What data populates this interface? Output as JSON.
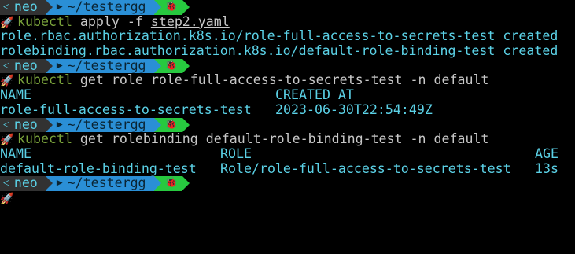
{
  "prompt": {
    "user": "neo",
    "dir": "~/testergg",
    "user_icon": "triangle-left-icon",
    "dir_icon": "folder-icon",
    "status_icon": "bug-icon",
    "colors": {
      "user_bg": "#323232",
      "dir_bg": "#2a8fd6",
      "status_bg": "#27c93f",
      "text": "#5bd1e6",
      "keyword": "#7aa33b"
    }
  },
  "blocks": [
    {
      "command": {
        "bin": "kubectl",
        "rest": " apply -f ",
        "file": "step2.yaml"
      },
      "output": [
        "role.rbac.authorization.k8s.io/role-full-access-to-secrets-test created",
        "rolebinding.rbac.authorization.k8s.io/default-role-binding-test created"
      ]
    },
    {
      "command": {
        "bin": "kubectl",
        "rest": " get role role-full-access-to-secrets-test -n default"
      },
      "table": {
        "headers": [
          "NAME",
          "CREATED AT"
        ],
        "rows": [
          [
            "role-full-access-to-secrets-test",
            "2023-06-30T22:54:49Z"
          ]
        ]
      }
    },
    {
      "command": {
        "bin": "kubectl",
        "rest": " get rolebinding default-role-binding-test -n default"
      },
      "table": {
        "headers": [
          "NAME",
          "ROLE",
          "AGE"
        ],
        "rows": [
          [
            "default-role-binding-test",
            "Role/role-full-access-to-secrets-test",
            "13s"
          ]
        ]
      }
    }
  ]
}
